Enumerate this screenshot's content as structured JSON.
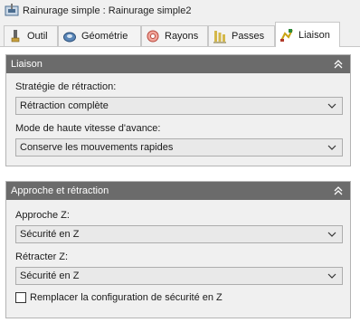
{
  "window": {
    "title": "Rainurage simple : Rainurage simple2"
  },
  "tabs": [
    {
      "label": "Outil",
      "icon": "tool-icon"
    },
    {
      "label": "Géométrie",
      "icon": "geometry-icon"
    },
    {
      "label": "Rayons",
      "icon": "radii-icon"
    },
    {
      "label": "Passes",
      "icon": "passes-icon"
    },
    {
      "label": "Liaison",
      "icon": "linking-icon",
      "active": true
    }
  ],
  "liaison": {
    "header": "Liaison",
    "retraction_label": "Stratégie de rétraction:",
    "retraction_value": "Rétraction complète",
    "feed_label": "Mode de haute vitesse d'avance:",
    "feed_value": "Conserve les mouvements rapides"
  },
  "approach": {
    "header": "Approche et rétraction",
    "approach_label": "Approche Z:",
    "approach_value": "Sécurité en Z",
    "retract_label": "Rétracter Z:",
    "retract_value": "Sécurité en Z",
    "override_label": "Remplacer la configuration de sécurité en Z",
    "override_checked": false
  }
}
